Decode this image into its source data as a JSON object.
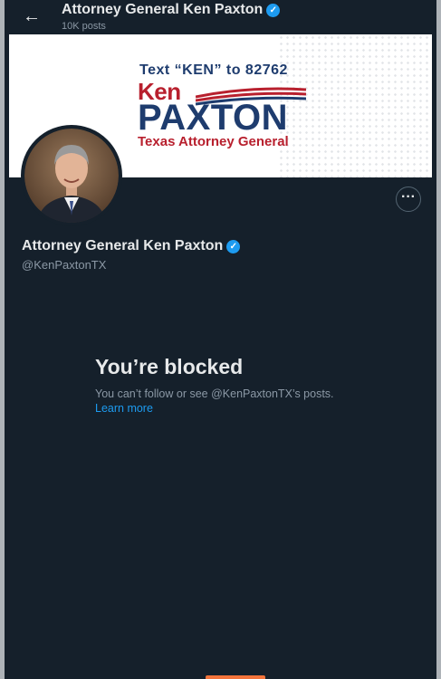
{
  "header": {
    "back_icon": "arrow-left-icon",
    "title": "Attorney General Ken Paxton",
    "posts_count": "10K posts"
  },
  "banner": {
    "text_line": "Text “KEN” to 82762",
    "ken": "Ken",
    "paxton": "PAXTON",
    "subtitle": "Texas Attorney General"
  },
  "profile": {
    "name": "Attorney General Ken Paxton",
    "handle": "@KenPaxtonTX",
    "verified_icon": "verified-badge-icon",
    "more_icon": "more-options-icon"
  },
  "blocked": {
    "title": "You’re blocked",
    "message": "You can’t follow or see @KenPaxtonTX’s posts.",
    "link": "Learn more"
  },
  "colors": {
    "background": "#15202b",
    "accent": "#1d9bf0",
    "banner_navy": "#1e3c6e",
    "banner_red": "#b8202e"
  }
}
